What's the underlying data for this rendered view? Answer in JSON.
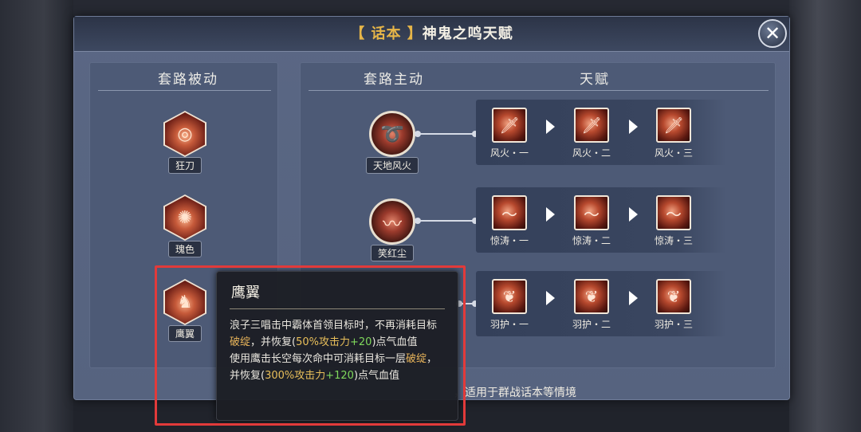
{
  "dialog": {
    "title_tag": "【 话本 】",
    "title_name": "神鬼之鸣天赋",
    "close_symbol": "✕"
  },
  "headers": {
    "passive": "套路被动",
    "active": "套路主动",
    "talent": "天赋"
  },
  "passive_skills": [
    {
      "label": "狂刀",
      "icon": "slash-swirl-icon"
    },
    {
      "label": "瑰色",
      "icon": "sunburst-icon"
    },
    {
      "label": "鹰翼",
      "icon": "warrior-figure-icon"
    }
  ],
  "active_skills": [
    {
      "label": "天地风火",
      "icon": "whirlwind-icon"
    },
    {
      "label": "笑红尘",
      "icon": "spin-slash-icon"
    }
  ],
  "talent_rows": [
    [
      "风火・一",
      "风火・二",
      "风火・三"
    ],
    [
      "惊涛・一",
      "惊涛・二",
      "惊涛・三"
    ],
    [
      "羽护・一",
      "羽护・二",
      "羽护・三"
    ]
  ],
  "footer": {
    "visible_text": "，适用于群战话本等情境"
  },
  "tooltip": {
    "title": "鹰翼",
    "line1_a": "浪子三唱击中霸体首领目标时，不再消耗目标",
    "line1_kw": "破绽",
    "line1_b": "，并恢复(",
    "line1_pct": "50%攻击力",
    "line1_plus": "+20",
    "line1_c": ")点气血值",
    "line2_a": "使用鹰击长空每次命中可消耗目标一层",
    "line2_kw": "破绽",
    "line2_b": "，并恢复(",
    "line2_pct": "300%攻击力",
    "line2_plus": "+120",
    "line2_c": ")点气血值"
  },
  "colors": {
    "title_tag": "#e6b548",
    "highlight": "#e23a3a",
    "keyword": "#e8b45a",
    "bonus": "#7fd85c"
  }
}
